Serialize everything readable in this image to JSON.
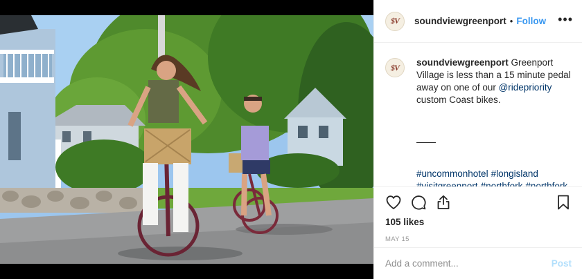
{
  "post": {
    "username": "soundviewgreenport",
    "dot": "•",
    "follow_label": "Follow",
    "more_label": "•••",
    "avatar_mark": "$V"
  },
  "caption": {
    "username": "soundviewgreenport",
    "text_before": " Greenport Village is less than a 15 minute pedal away on one of our ",
    "mention": "@ridepriority",
    "text_after": " custom Coast bikes."
  },
  "hashtags": [
    "#uncommonhotel",
    "#longisland",
    "#visitgreenport",
    "#northfork",
    "#northfork"
  ],
  "engagement": {
    "likes": "105 likes",
    "date": "MAY 15"
  },
  "comment_box": {
    "placeholder": "Add a comment...",
    "post_label": "Post"
  },
  "icons": {
    "like": "heart-icon",
    "comment": "comment-icon",
    "share": "share-icon",
    "save": "bookmark-icon",
    "more": "more-icon"
  },
  "colors": {
    "link": "#3897f0",
    "mention": "#003569",
    "post_disabled": "#b2dffc",
    "date": "#999999"
  }
}
